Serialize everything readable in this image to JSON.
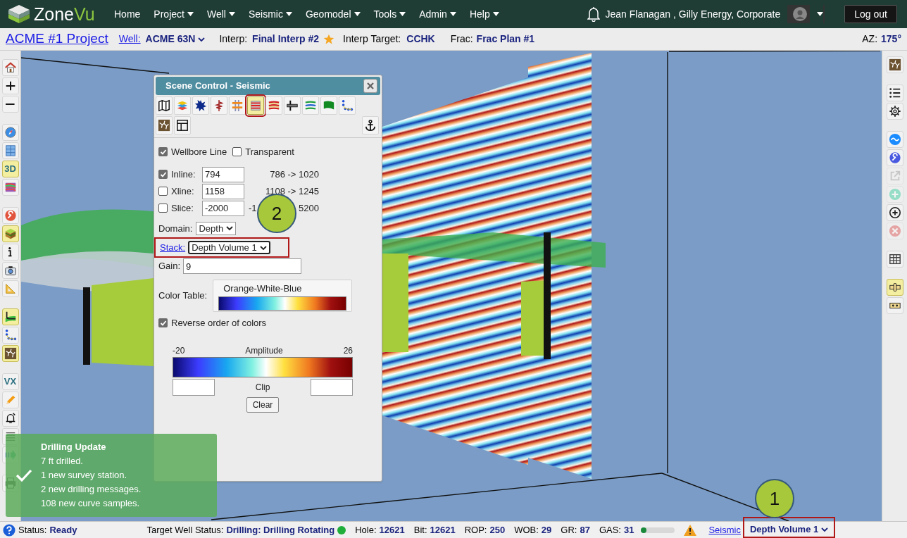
{
  "nav": {
    "logo_parts": [
      "Zone",
      "Vu"
    ],
    "menu": [
      {
        "label": "Home",
        "dropdown": false
      },
      {
        "label": "Project",
        "dropdown": true
      },
      {
        "label": "Well",
        "dropdown": true
      },
      {
        "label": "Seismic",
        "dropdown": true
      },
      {
        "label": "Geomodel",
        "dropdown": true
      },
      {
        "label": "Tools",
        "dropdown": true
      },
      {
        "label": "Admin",
        "dropdown": true
      },
      {
        "label": "Help",
        "dropdown": true
      }
    ],
    "user": "Jean Flanagan , Gilly Energy, Corporate",
    "logout": "Log out"
  },
  "header": {
    "project": "ACME #1 Project",
    "well_label": "Well:",
    "well": "ACME 63N",
    "interp_label": "Interp:",
    "interp": "Final Interp #2",
    "interp_starred": true,
    "target_label": "Interp Target:",
    "target": "CCHK",
    "frac_label": "Frac:",
    "frac": "Frac Plan #1",
    "az_label": "AZ:",
    "az": "175°"
  },
  "left_toolbar": [
    [
      {
        "kind": "home",
        "active": false
      },
      {
        "kind": "plus",
        "active": false
      },
      {
        "kind": "minus",
        "active": false
      }
    ],
    [
      {
        "kind": "compass",
        "active": false
      },
      {
        "kind": "grid",
        "active": false
      },
      {
        "kind": "label",
        "label": "3D",
        "active": true
      },
      {
        "kind": "sections",
        "active": false
      }
    ],
    [
      {
        "kind": "wrench",
        "active": false
      },
      {
        "kind": "cube",
        "active": true
      },
      {
        "kind": "info",
        "active": false
      },
      {
        "kind": "camera",
        "active": false
      },
      {
        "kind": "ruler",
        "active": false
      }
    ],
    [
      {
        "kind": "wellbore",
        "active": true
      },
      {
        "kind": "dots",
        "active": false
      },
      {
        "kind": "branch",
        "active": true
      }
    ],
    [
      {
        "kind": "label",
        "label": "VX",
        "active": false
      },
      {
        "kind": "pencil",
        "active": false
      },
      {
        "kind": "bell",
        "active": false
      },
      {
        "kind": "list",
        "active": false
      },
      {
        "kind": "arrow",
        "active": false
      }
    ],
    [
      {
        "kind": "printer",
        "active": false
      }
    ]
  ],
  "right_toolbar": [
    [
      {
        "kind": "branch",
        "active": false,
        "disabled": false
      }
    ],
    [
      {
        "kind": "bullets",
        "active": false,
        "disabled": false
      },
      {
        "kind": "gear",
        "active": false,
        "disabled": false
      }
    ],
    [
      {
        "kind": "wave",
        "active": false,
        "disabled": false
      },
      {
        "kind": "wrenchblue",
        "active": false,
        "disabled": false
      },
      {
        "kind": "external",
        "active": false,
        "disabled": true
      },
      {
        "kind": "plusgreen",
        "active": false,
        "disabled": true
      },
      {
        "kind": "pluscircle",
        "active": false,
        "disabled": false
      },
      {
        "kind": "xcircle",
        "active": false,
        "disabled": true
      }
    ],
    [
      {
        "kind": "table",
        "active": false,
        "disabled": false
      }
    ],
    [
      {
        "kind": "slider",
        "active": true,
        "disabled": false
      },
      {
        "kind": "tape",
        "active": false,
        "disabled": false
      }
    ]
  ],
  "scene_control": {
    "title": "Scene Control - Seismic",
    "tools": [
      {
        "kind": "map",
        "selected": false,
        "highlighted": false
      },
      {
        "kind": "layers",
        "selected": false,
        "highlighted": false
      },
      {
        "kind": "star",
        "selected": false,
        "highlighted": false
      },
      {
        "kind": "wellsign",
        "selected": false,
        "highlighted": false
      },
      {
        "kind": "horizon",
        "selected": false,
        "highlighted": false
      },
      {
        "kind": "stack",
        "selected": true,
        "highlighted": true
      },
      {
        "kind": "stripes",
        "selected": false,
        "highlighted": false
      },
      {
        "kind": "marker",
        "selected": false,
        "highlighted": false
      },
      {
        "kind": "lines",
        "selected": false,
        "highlighted": false
      },
      {
        "kind": "flag",
        "selected": false,
        "highlighted": false
      },
      {
        "kind": "dots",
        "selected": false,
        "highlighted": false
      }
    ],
    "tools_row2": [
      {
        "kind": "branch",
        "selected": false,
        "highlighted": false
      },
      {
        "kind": "layout",
        "selected": false,
        "highlighted": false
      }
    ],
    "wellbore_line": {
      "label": "Wellbore Line",
      "checked": true
    },
    "transparent": {
      "label": "Transparent",
      "checked": false
    },
    "planes": [
      {
        "label": "Inline:",
        "checked": true,
        "value": "794",
        "range_parts": [
          "786 -> 1020"
        ]
      },
      {
        "label": "Xline:",
        "checked": false,
        "value": "1158",
        "range_parts": [
          "1108 -> 1245"
        ]
      },
      {
        "label": "Slice:",
        "checked": false,
        "value": "-2000",
        "range_parts": [
          "-1",
          "5200"
        ]
      }
    ],
    "callout": "2",
    "domain": {
      "label": "Domain:",
      "value": "Depth"
    },
    "stack": {
      "label": "Stack:",
      "value": "Depth Volume 1",
      "highlighted": true
    },
    "gain": {
      "label": "Gain:",
      "value": "9"
    },
    "color_table": {
      "label": "Color Table:",
      "name": "Orange-White-Blue"
    },
    "reverse": {
      "label": "Reverse order of colors",
      "checked": true
    },
    "amplitude": {
      "min": "-20",
      "title": "Amplitude",
      "max": "26"
    },
    "clip_label": "Clip",
    "clear": "Clear"
  },
  "toast": {
    "title": "Drilling Update",
    "lines": [
      "7 ft drilled.",
      "1 new survey station.",
      "2 new drilling messages.",
      "108 new curve samples."
    ]
  },
  "status_bar": {
    "status_label": "Status:",
    "status": "Ready",
    "target_label": "Target Well Status:",
    "target": "Drilling: Drilling Rotating",
    "readings": [
      {
        "label": "Hole:",
        "value": "12621"
      },
      {
        "label": "Bit:",
        "value": "12621"
      },
      {
        "label": "ROP:",
        "value": "250"
      },
      {
        "label": "WOB:",
        "value": "29"
      },
      {
        "label": "GR:",
        "value": "87"
      },
      {
        "label": "GAS:",
        "value": "31"
      }
    ],
    "gas": {
      "level": 0.05
    },
    "warning": true,
    "seismic_link": "Seismic",
    "volume": "Depth Volume 1",
    "volume_highlighted": true,
    "callout": "1"
  }
}
